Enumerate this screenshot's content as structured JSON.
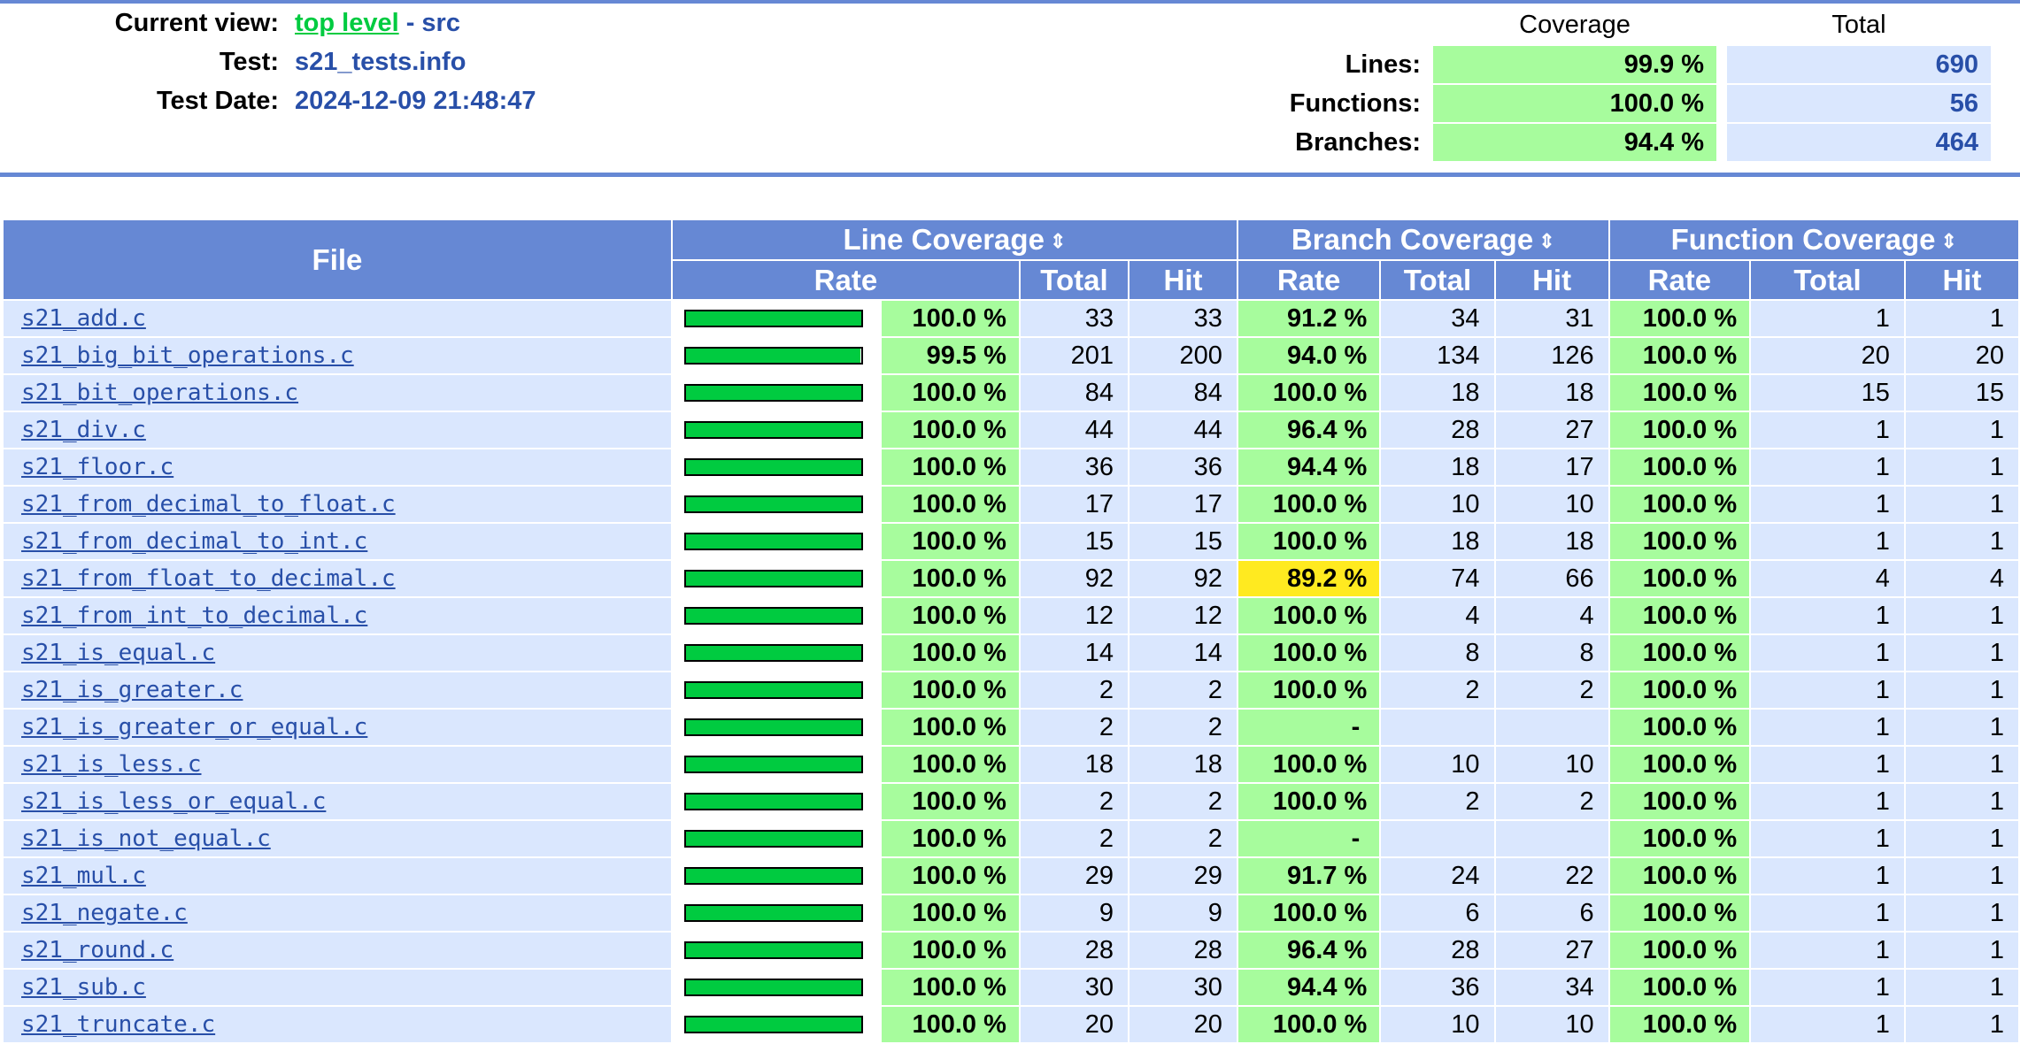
{
  "header": {
    "current_view_label": "Current view:",
    "top_level_link": "top level",
    "view_suffix": " - src",
    "test_label": "Test:",
    "test_value": "s21_tests.info",
    "date_label": "Test Date:",
    "date_value": "2024-12-09 21:48:47"
  },
  "summary": {
    "coverage_head": "Coverage",
    "total_head": "Total",
    "rows": [
      {
        "label": "Lines:",
        "rate": "99.9 %",
        "total": "690"
      },
      {
        "label": "Functions:",
        "rate": "100.0 %",
        "total": "56"
      },
      {
        "label": "Branches:",
        "rate": "94.4 %",
        "total": "464"
      }
    ]
  },
  "table": {
    "file_head": "File",
    "line_head": "Line Coverage",
    "branch_head": "Branch Coverage",
    "function_head": "Function Coverage",
    "rate_head": "Rate",
    "total_head": "Total",
    "hit_head": "Hit",
    "sort_icon": "⇕",
    "rows": [
      {
        "file": "s21_add.c",
        "line_pct": 100.0,
        "line_rate": "100.0 %",
        "line_total": "33",
        "line_hit": "33",
        "branch_rate": "91.2 %",
        "branch_total": "34",
        "branch_hit": "31",
        "func_rate": "100.0 %",
        "func_total": "1",
        "func_hit": "1"
      },
      {
        "file": "s21_big_bit_operations.c",
        "line_pct": 99.5,
        "line_rate": "99.5 %",
        "line_total": "201",
        "line_hit": "200",
        "branch_rate": "94.0 %",
        "branch_total": "134",
        "branch_hit": "126",
        "func_rate": "100.0 %",
        "func_total": "20",
        "func_hit": "20"
      },
      {
        "file": "s21_bit_operations.c",
        "line_pct": 100.0,
        "line_rate": "100.0 %",
        "line_total": "84",
        "line_hit": "84",
        "branch_rate": "100.0 %",
        "branch_total": "18",
        "branch_hit": "18",
        "func_rate": "100.0 %",
        "func_total": "15",
        "func_hit": "15"
      },
      {
        "file": "s21_div.c",
        "line_pct": 100.0,
        "line_rate": "100.0 %",
        "line_total": "44",
        "line_hit": "44",
        "branch_rate": "96.4 %",
        "branch_total": "28",
        "branch_hit": "27",
        "func_rate": "100.0 %",
        "func_total": "1",
        "func_hit": "1"
      },
      {
        "file": "s21_floor.c",
        "line_pct": 100.0,
        "line_rate": "100.0 %",
        "line_total": "36",
        "line_hit": "36",
        "branch_rate": "94.4 %",
        "branch_total": "18",
        "branch_hit": "17",
        "func_rate": "100.0 %",
        "func_total": "1",
        "func_hit": "1"
      },
      {
        "file": "s21_from_decimal_to_float.c",
        "line_pct": 100.0,
        "line_rate": "100.0 %",
        "line_total": "17",
        "line_hit": "17",
        "branch_rate": "100.0 %",
        "branch_total": "10",
        "branch_hit": "10",
        "func_rate": "100.0 %",
        "func_total": "1",
        "func_hit": "1"
      },
      {
        "file": "s21_from_decimal_to_int.c",
        "line_pct": 100.0,
        "line_rate": "100.0 %",
        "line_total": "15",
        "line_hit": "15",
        "branch_rate": "100.0 %",
        "branch_total": "18",
        "branch_hit": "18",
        "func_rate": "100.0 %",
        "func_total": "1",
        "func_hit": "1"
      },
      {
        "file": "s21_from_float_to_decimal.c",
        "line_pct": 100.0,
        "line_rate": "100.0 %",
        "line_total": "92",
        "line_hit": "92",
        "branch_rate": "89.2 %",
        "branch_level": "med",
        "branch_total": "74",
        "branch_hit": "66",
        "func_rate": "100.0 %",
        "func_total": "4",
        "func_hit": "4"
      },
      {
        "file": "s21_from_int_to_decimal.c",
        "line_pct": 100.0,
        "line_rate": "100.0 %",
        "line_total": "12",
        "line_hit": "12",
        "branch_rate": "100.0 %",
        "branch_total": "4",
        "branch_hit": "4",
        "func_rate": "100.0 %",
        "func_total": "1",
        "func_hit": "1"
      },
      {
        "file": "s21_is_equal.c",
        "line_pct": 100.0,
        "line_rate": "100.0 %",
        "line_total": "14",
        "line_hit": "14",
        "branch_rate": "100.0 %",
        "branch_total": "8",
        "branch_hit": "8",
        "func_rate": "100.0 %",
        "func_total": "1",
        "func_hit": "1"
      },
      {
        "file": "s21_is_greater.c",
        "line_pct": 100.0,
        "line_rate": "100.0 %",
        "line_total": "2",
        "line_hit": "2",
        "branch_rate": "100.0 %",
        "branch_total": "2",
        "branch_hit": "2",
        "func_rate": "100.0 %",
        "func_total": "1",
        "func_hit": "1"
      },
      {
        "file": "s21_is_greater_or_equal.c",
        "line_pct": 100.0,
        "line_rate": "100.0 %",
        "line_total": "2",
        "line_hit": "2",
        "branch_rate": "-",
        "branch_total": "",
        "branch_hit": "",
        "func_rate": "100.0 %",
        "func_total": "1",
        "func_hit": "1"
      },
      {
        "file": "s21_is_less.c",
        "line_pct": 100.0,
        "line_rate": "100.0 %",
        "line_total": "18",
        "line_hit": "18",
        "branch_rate": "100.0 %",
        "branch_total": "10",
        "branch_hit": "10",
        "func_rate": "100.0 %",
        "func_total": "1",
        "func_hit": "1"
      },
      {
        "file": "s21_is_less_or_equal.c",
        "line_pct": 100.0,
        "line_rate": "100.0 %",
        "line_total": "2",
        "line_hit": "2",
        "branch_rate": "100.0 %",
        "branch_total": "2",
        "branch_hit": "2",
        "func_rate": "100.0 %",
        "func_total": "1",
        "func_hit": "1"
      },
      {
        "file": "s21_is_not_equal.c",
        "line_pct": 100.0,
        "line_rate": "100.0 %",
        "line_total": "2",
        "line_hit": "2",
        "branch_rate": "-",
        "branch_total": "",
        "branch_hit": "",
        "func_rate": "100.0 %",
        "func_total": "1",
        "func_hit": "1"
      },
      {
        "file": "s21_mul.c",
        "line_pct": 100.0,
        "line_rate": "100.0 %",
        "line_total": "29",
        "line_hit": "29",
        "branch_rate": "91.7 %",
        "branch_total": "24",
        "branch_hit": "22",
        "func_rate": "100.0 %",
        "func_total": "1",
        "func_hit": "1"
      },
      {
        "file": "s21_negate.c",
        "line_pct": 100.0,
        "line_rate": "100.0 %",
        "line_total": "9",
        "line_hit": "9",
        "branch_rate": "100.0 %",
        "branch_total": "6",
        "branch_hit": "6",
        "func_rate": "100.0 %",
        "func_total": "1",
        "func_hit": "1"
      },
      {
        "file": "s21_round.c",
        "line_pct": 100.0,
        "line_rate": "100.0 %",
        "line_total": "28",
        "line_hit": "28",
        "branch_rate": "96.4 %",
        "branch_total": "28",
        "branch_hit": "27",
        "func_rate": "100.0 %",
        "func_total": "1",
        "func_hit": "1"
      },
      {
        "file": "s21_sub.c",
        "line_pct": 100.0,
        "line_rate": "100.0 %",
        "line_total": "30",
        "line_hit": "30",
        "branch_rate": "94.4 %",
        "branch_total": "36",
        "branch_hit": "34",
        "func_rate": "100.0 %",
        "func_total": "1",
        "func_hit": "1"
      },
      {
        "file": "s21_truncate.c",
        "line_pct": 100.0,
        "line_rate": "100.0 %",
        "line_total": "20",
        "line_hit": "20",
        "branch_rate": "100.0 %",
        "branch_total": "10",
        "branch_hit": "10",
        "func_rate": "100.0 %",
        "func_total": "1",
        "func_hit": "1"
      }
    ]
  }
}
